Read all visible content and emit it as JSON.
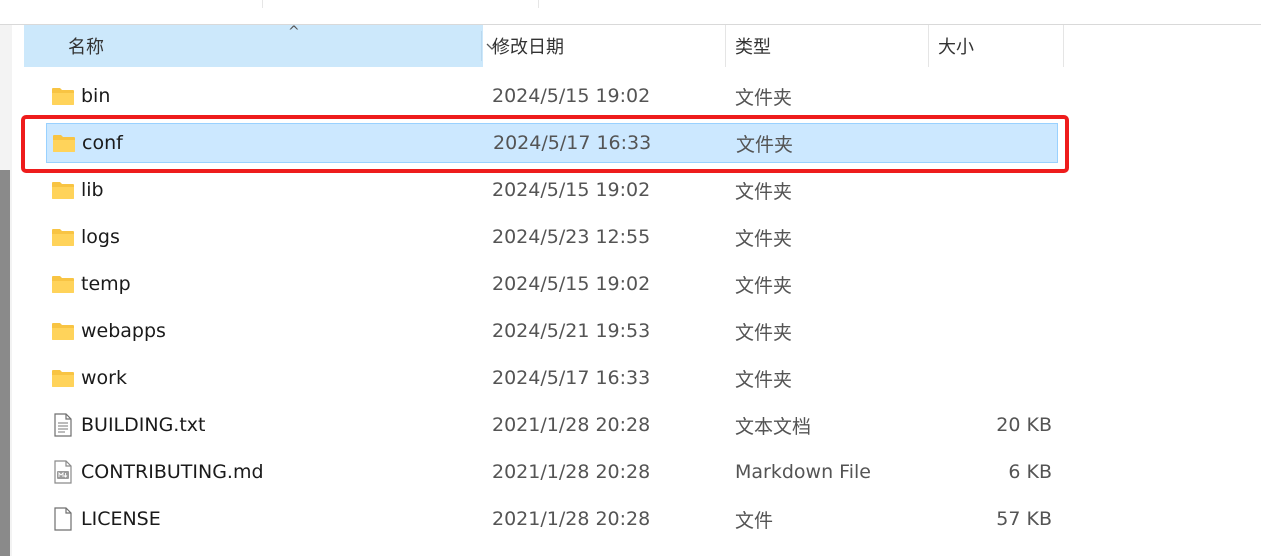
{
  "header": {
    "name": "名称",
    "date": "修改日期",
    "type": "类型",
    "size": "大小",
    "sort_arrow": "^"
  },
  "rows": [
    {
      "name": "bin",
      "date": "2024/5/15 19:02",
      "type": "文件夹",
      "size": "",
      "icon": "folder-icon"
    },
    {
      "name": "conf",
      "date": "2024/5/17 16:33",
      "type": "文件夹",
      "size": "",
      "icon": "folder-icon",
      "selected": true
    },
    {
      "name": "lib",
      "date": "2024/5/15 19:02",
      "type": "文件夹",
      "size": "",
      "icon": "folder-icon"
    },
    {
      "name": "logs",
      "date": "2024/5/23 12:55",
      "type": "文件夹",
      "size": "",
      "icon": "folder-icon"
    },
    {
      "name": "temp",
      "date": "2024/5/15 19:02",
      "type": "文件夹",
      "size": "",
      "icon": "folder-icon"
    },
    {
      "name": "webapps",
      "date": "2024/5/21 19:53",
      "type": "文件夹",
      "size": "",
      "icon": "folder-icon"
    },
    {
      "name": "work",
      "date": "2024/5/17 16:33",
      "type": "文件夹",
      "size": "",
      "icon": "folder-icon"
    },
    {
      "name": "BUILDING.txt",
      "date": "2021/1/28 20:28",
      "type": "文本文档",
      "size": "20 KB",
      "icon": "text-file-icon"
    },
    {
      "name": "CONTRIBUTING.md",
      "date": "2021/1/28 20:28",
      "type": "Markdown File",
      "size": "6 KB",
      "icon": "markdown-file-icon"
    },
    {
      "name": "LICENSE",
      "date": "2021/1/28 20:28",
      "type": "文件",
      "size": "57 KB",
      "icon": "file-icon"
    }
  ],
  "colors": {
    "selection": "#cce8ff",
    "highlight": "#ee1c1c",
    "folder": "#f8c443"
  }
}
